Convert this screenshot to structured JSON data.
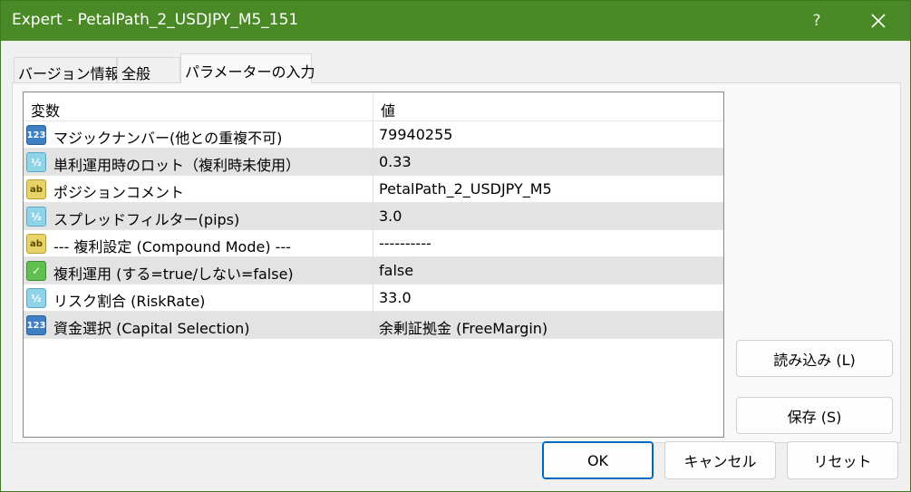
{
  "window": {
    "title": "Expert - PetalPath_2_USDJPY_M5_151",
    "help_label": "?",
    "close_label": "✕"
  },
  "tabs": [
    {
      "label": "バージョン情報"
    },
    {
      "label": "全般"
    },
    {
      "label": "パラメーターの入力",
      "active": true
    }
  ],
  "grid": {
    "headers": {
      "variable": "変数",
      "value": "値"
    },
    "rows": [
      {
        "icon": "123",
        "name": "マジックナンバー(他との重複不可)",
        "value": "79940255"
      },
      {
        "icon": "½",
        "name": "単利運用時のロット（複利時未使用）",
        "value": "0.33"
      },
      {
        "icon": "ab",
        "name": "ポジションコメント",
        "value": "PetalPath_2_USDJPY_M5"
      },
      {
        "icon": "½",
        "name": "スプレッドフィルター(pips)",
        "value": "3.0"
      },
      {
        "icon": "ab",
        "name": "--- 複利設定 (Compound Mode) ---",
        "value": "----------"
      },
      {
        "icon": "✓",
        "name": "複利運用 (する=true/しない=false)",
        "value": "false"
      },
      {
        "icon": "½",
        "name": "リスク割合 (RiskRate)",
        "value": "33.0"
      },
      {
        "icon": "123",
        "name": "資金選択 (Capital Selection)",
        "value": "余剰証拠金 (FreeMargin)"
      }
    ]
  },
  "side_buttons": {
    "load": "読み込み (L)",
    "save": "保存 (S)"
  },
  "footer_buttons": {
    "ok": "OK",
    "cancel": "キャンセル",
    "reset": "リセット"
  }
}
